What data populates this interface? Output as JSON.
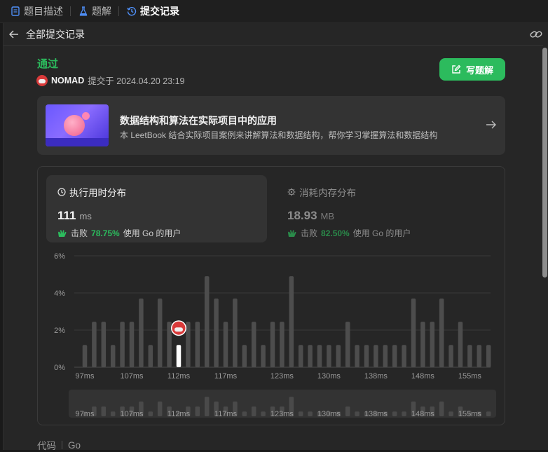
{
  "tabs": [
    {
      "label": "题目描述",
      "icon": "document-icon",
      "active": false
    },
    {
      "label": "题解",
      "icon": "flask-icon",
      "active": false
    },
    {
      "label": "提交记录",
      "icon": "history-icon",
      "active": true
    }
  ],
  "subheader": {
    "title": "全部提交记录",
    "back_icon": "arrow-left-icon",
    "share_icon": "link-icon"
  },
  "submission": {
    "status": "通过",
    "user": "NOMAD",
    "submitted_text": "提交于 2024.04.20 23:19",
    "write_button": "写题解",
    "accent": "#2cbb5d"
  },
  "book": {
    "title": "数据结构和算法在实际项目中的应用",
    "description": "本 LeetBook 结合实际项目案例来讲解算法和数据结构，帮你学习掌握算法和数据结构"
  },
  "runtime_card": {
    "title": "执行用时分布",
    "value": "111",
    "unit": "ms",
    "beat_prefix": "击败",
    "beat_pct": "78.75%",
    "beat_suffix": "使用 Go 的用户"
  },
  "memory_card": {
    "title": "消耗内存分布",
    "value": "18.93",
    "unit": "MB",
    "beat_prefix": "击败",
    "beat_pct": "82.50%",
    "beat_suffix": "使用 Go 的用户"
  },
  "chart_data": {
    "type": "bar",
    "y_ticks": [
      "6%",
      "4%",
      "2%",
      "0%"
    ],
    "ylim": [
      0,
      6
    ],
    "x_tick_labels": [
      "97ms",
      "107ms",
      "112ms",
      "117ms",
      "123ms",
      "130ms",
      "138ms",
      "148ms",
      "155ms"
    ],
    "values": [
      1.2,
      2.45,
      2.45,
      1.2,
      2.45,
      2.45,
      3.7,
      1.2,
      3.7,
      2.45,
      1.2,
      2.45,
      2.45,
      4.9,
      3.7,
      2.45,
      3.7,
      1.2,
      2.45,
      1.2,
      2.45,
      2.45,
      4.9,
      1.2,
      1.2,
      1.2,
      1.2,
      1.2,
      2.45,
      1.2,
      1.2,
      1.2,
      1.2,
      1.2,
      1.2,
      3.7,
      2.45,
      2.45,
      3.7,
      1.2,
      2.45,
      1.2,
      1.2,
      1.2
    ],
    "highlight_index": 10,
    "grid": true
  },
  "code": {
    "label": "代码",
    "language": "Go"
  }
}
